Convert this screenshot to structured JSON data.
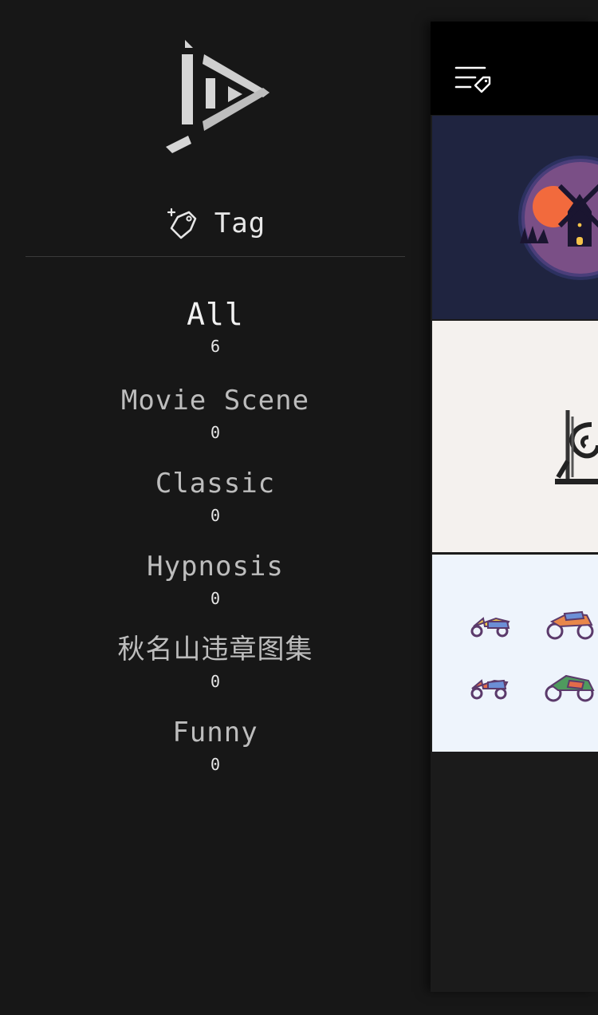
{
  "drawer": {
    "title": "Tag",
    "logo_icon": "play-logo-icon",
    "tag_icon": "tag-sparkle-icon",
    "tags": [
      {
        "name": "All",
        "count": "6",
        "active": true
      },
      {
        "name": "Movie Scene",
        "count": "0"
      },
      {
        "name": "Classic",
        "count": "0"
      },
      {
        "name": "Hypnosis",
        "count": "0"
      },
      {
        "name": "秋名山违章图集",
        "count": "0"
      },
      {
        "name": "Funny",
        "count": "0"
      }
    ]
  },
  "main": {
    "menu_icon": "tag-menu-icon",
    "cards": [
      {
        "thumbnail": "windmill-night-thumbnail"
      },
      {
        "thumbnail": "hypnosis-spiral-thumbnail"
      },
      {
        "thumbnail": "scooters-motorcycles-thumbnail"
      }
    ]
  },
  "colors": {
    "background": "#171717",
    "topbar": "#000000",
    "text_active": "#f2f2f2",
    "text_inactive": "#bdbdbd"
  }
}
